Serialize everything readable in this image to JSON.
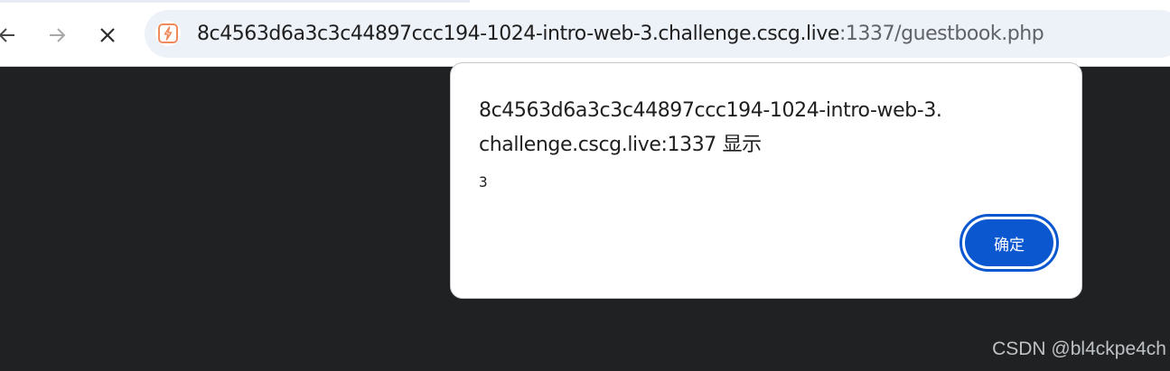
{
  "browser": {
    "url_host": "8c4563d6a3c3c44897ccc194-1024-intro-web-3.challenge.cscg.live",
    "url_rest": ":1337/guestbook.php",
    "icons": {
      "back": "arrow-left-icon",
      "forward": "arrow-right-icon",
      "stop": "close-icon",
      "site": "site-info-icon"
    }
  },
  "dialog": {
    "title": "8c4563d6a3c3c44897ccc194-1024-intro-web-3.challenge.cscg.live:1337 显示",
    "message": "3",
    "ok_label": "确定"
  },
  "watermark": "CSDN @bl4ckpe4ch",
  "colors": {
    "page_background": "#1f2123",
    "accent": "#0b57d0",
    "site_icon": "#f08a5d"
  }
}
